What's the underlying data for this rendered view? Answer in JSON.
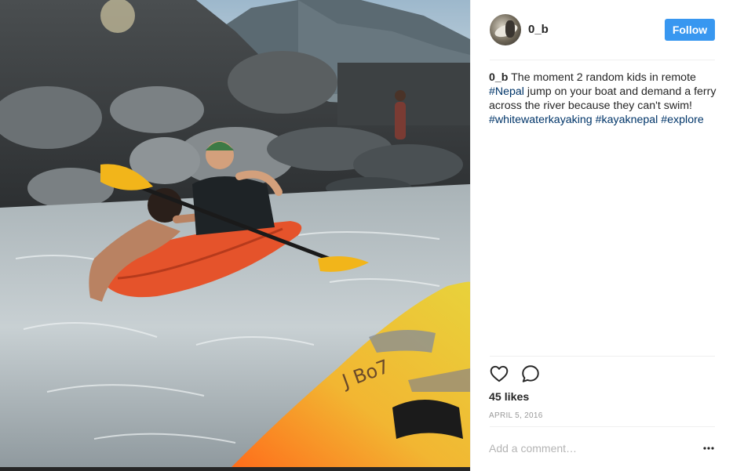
{
  "post": {
    "username": "0_b",
    "follow_label": "Follow",
    "caption": {
      "username": "0_b",
      "parts": [
        {
          "text": " The moment 2 random kids in remote ",
          "type": "text"
        },
        {
          "text": "#Nepal",
          "type": "tag"
        },
        {
          "text": " jump on your boat and demand a ferry across the river because they can't swim! ",
          "type": "text"
        },
        {
          "text": "#whitewaterkayaking",
          "type": "tag"
        },
        {
          "text": " ",
          "type": "text"
        },
        {
          "text": "#kayaknepal",
          "type": "tag"
        },
        {
          "text": " ",
          "type": "text"
        },
        {
          "text": "#explore",
          "type": "tag"
        }
      ]
    },
    "likes_label": "45 likes",
    "date_label": "APRIL 5, 2016",
    "comment_placeholder": "Add a comment…"
  },
  "photo": {
    "kayak_marking": "J Bo7"
  },
  "icons": {
    "like": "heart-icon",
    "comment": "comment-icon",
    "more": "more-options-icon"
  },
  "colors": {
    "follow_button": "#3897f0",
    "hashtag": "#003569",
    "meta_gray": "#999999"
  }
}
